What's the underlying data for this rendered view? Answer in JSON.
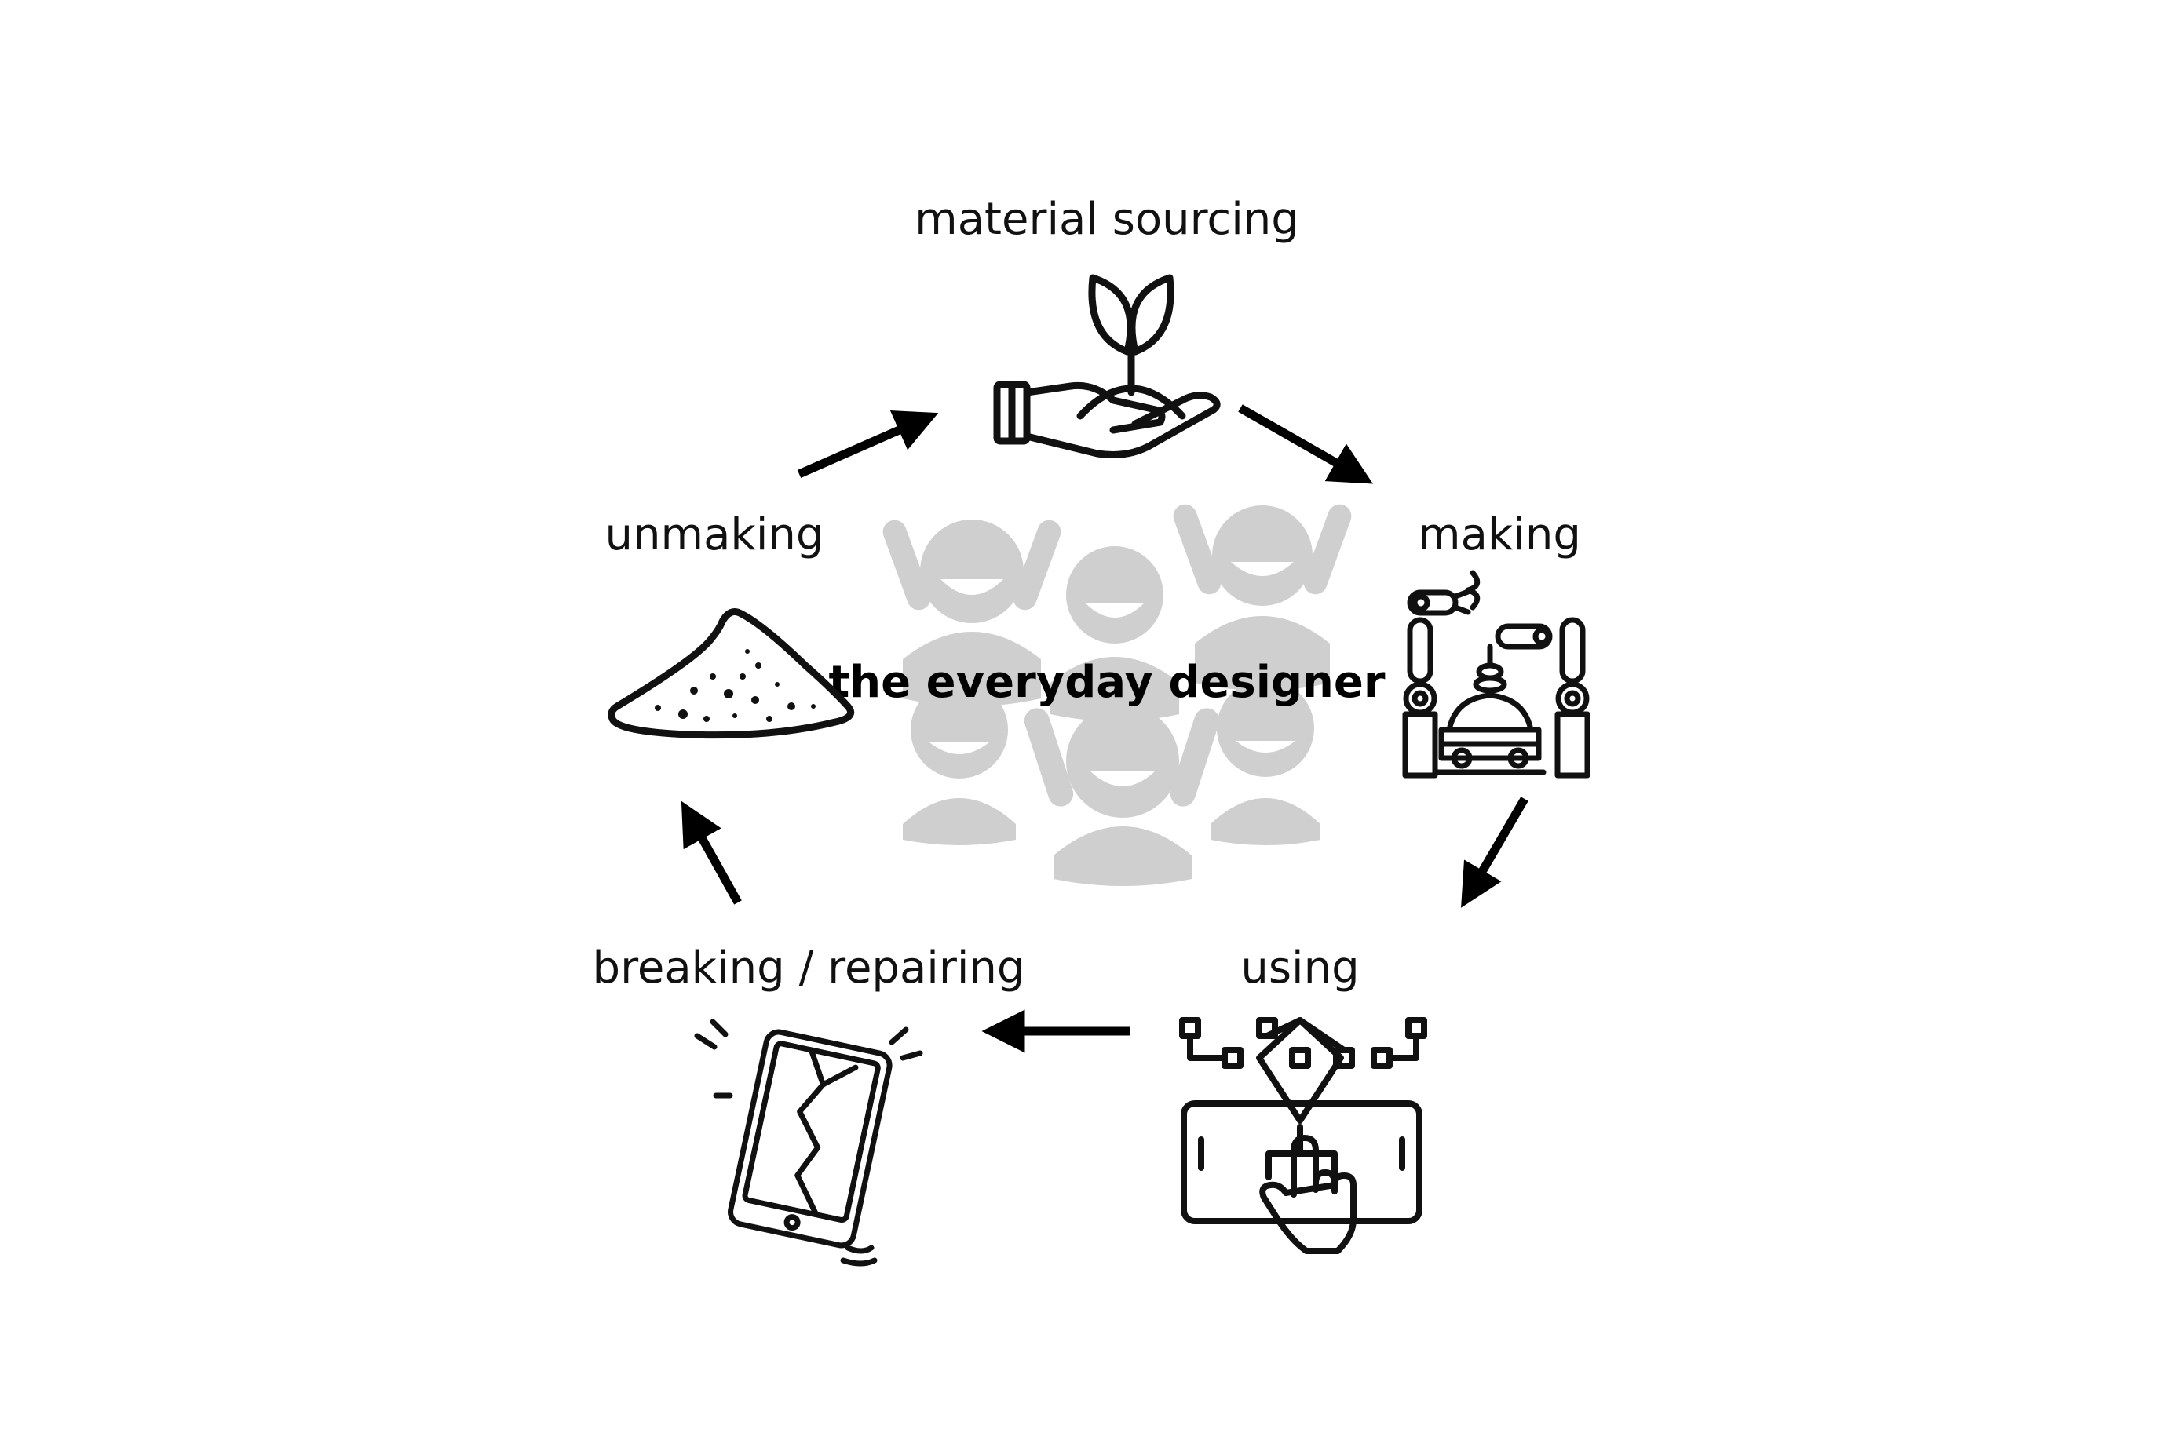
{
  "center": {
    "title": "the everyday designer"
  },
  "stages": {
    "material_sourcing": {
      "label": "material sourcing",
      "icon": "hand-holding-sprout-icon"
    },
    "making": {
      "label": "making",
      "icon": "robotic-assembly-line-icon"
    },
    "using": {
      "label": "using",
      "icon": "touchscreen-interface-icon"
    },
    "breaking_repairing": {
      "label": "breaking / repairing",
      "icon": "cracked-phone-icon"
    },
    "unmaking": {
      "label": "unmaking",
      "icon": "pile-of-dust-icon"
    }
  },
  "colors": {
    "foreground": "#111111",
    "people_background": "#cfcfcf",
    "background": "#ffffff"
  }
}
